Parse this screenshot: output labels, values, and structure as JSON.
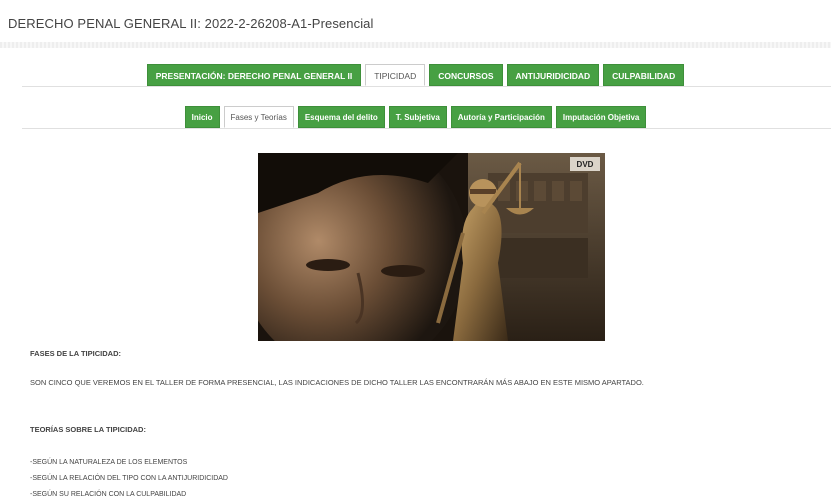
{
  "course": {
    "title": "DERECHO PENAL GENERAL II: 2022-2-26208-A1-Presencial"
  },
  "main_tabs": [
    {
      "label": "PRESENTACIÓN: DERECHO PENAL GENERAL II",
      "active": false
    },
    {
      "label": "TIPICIDAD",
      "active": true
    },
    {
      "label": "CONCURSOS",
      "active": false
    },
    {
      "label": "ANTIJURIDICIDAD",
      "active": false
    },
    {
      "label": "CULPABILIDAD",
      "active": false
    }
  ],
  "sub_tabs": [
    {
      "label": "Inicio",
      "active": false
    },
    {
      "label": "Fases y Teorías",
      "active": true
    },
    {
      "label": "Esquema del delito",
      "active": false
    },
    {
      "label": "T. Subjetiva",
      "active": false
    },
    {
      "label": "Autoría y Participación",
      "active": false
    },
    {
      "label": "Imputación Objetiva",
      "active": false
    }
  ],
  "hero": {
    "corner_label": "DVD"
  },
  "content": {
    "heading_phases": "FASES DE LA TIPICIDAD:",
    "paragraph_phases": "SON CINCO QUE VEREMOS EN EL TALLER DE FORMA PRESENCIAL, LAS INDICACIONES DE DICHO TALLER LAS ENCONTRARÁN MÁS ABAJO EN ESTE MISMO APARTADO.",
    "heading_theories": "TEORÍAS SOBRE LA TIPICIDAD:",
    "theories": [
      "-SEGÚN LA NATURALEZA DE LOS ELEMENTOS",
      "-SEGÚN LA RELACIÓN DEL TIPO CON LA ANTIJURIDICIDAD",
      "-SEGÚN SU RELACIÓN CON LA CULPABILIDAD"
    ]
  },
  "colors": {
    "tab_green": "#47a043",
    "tab_active_bg": "#ffffff"
  }
}
